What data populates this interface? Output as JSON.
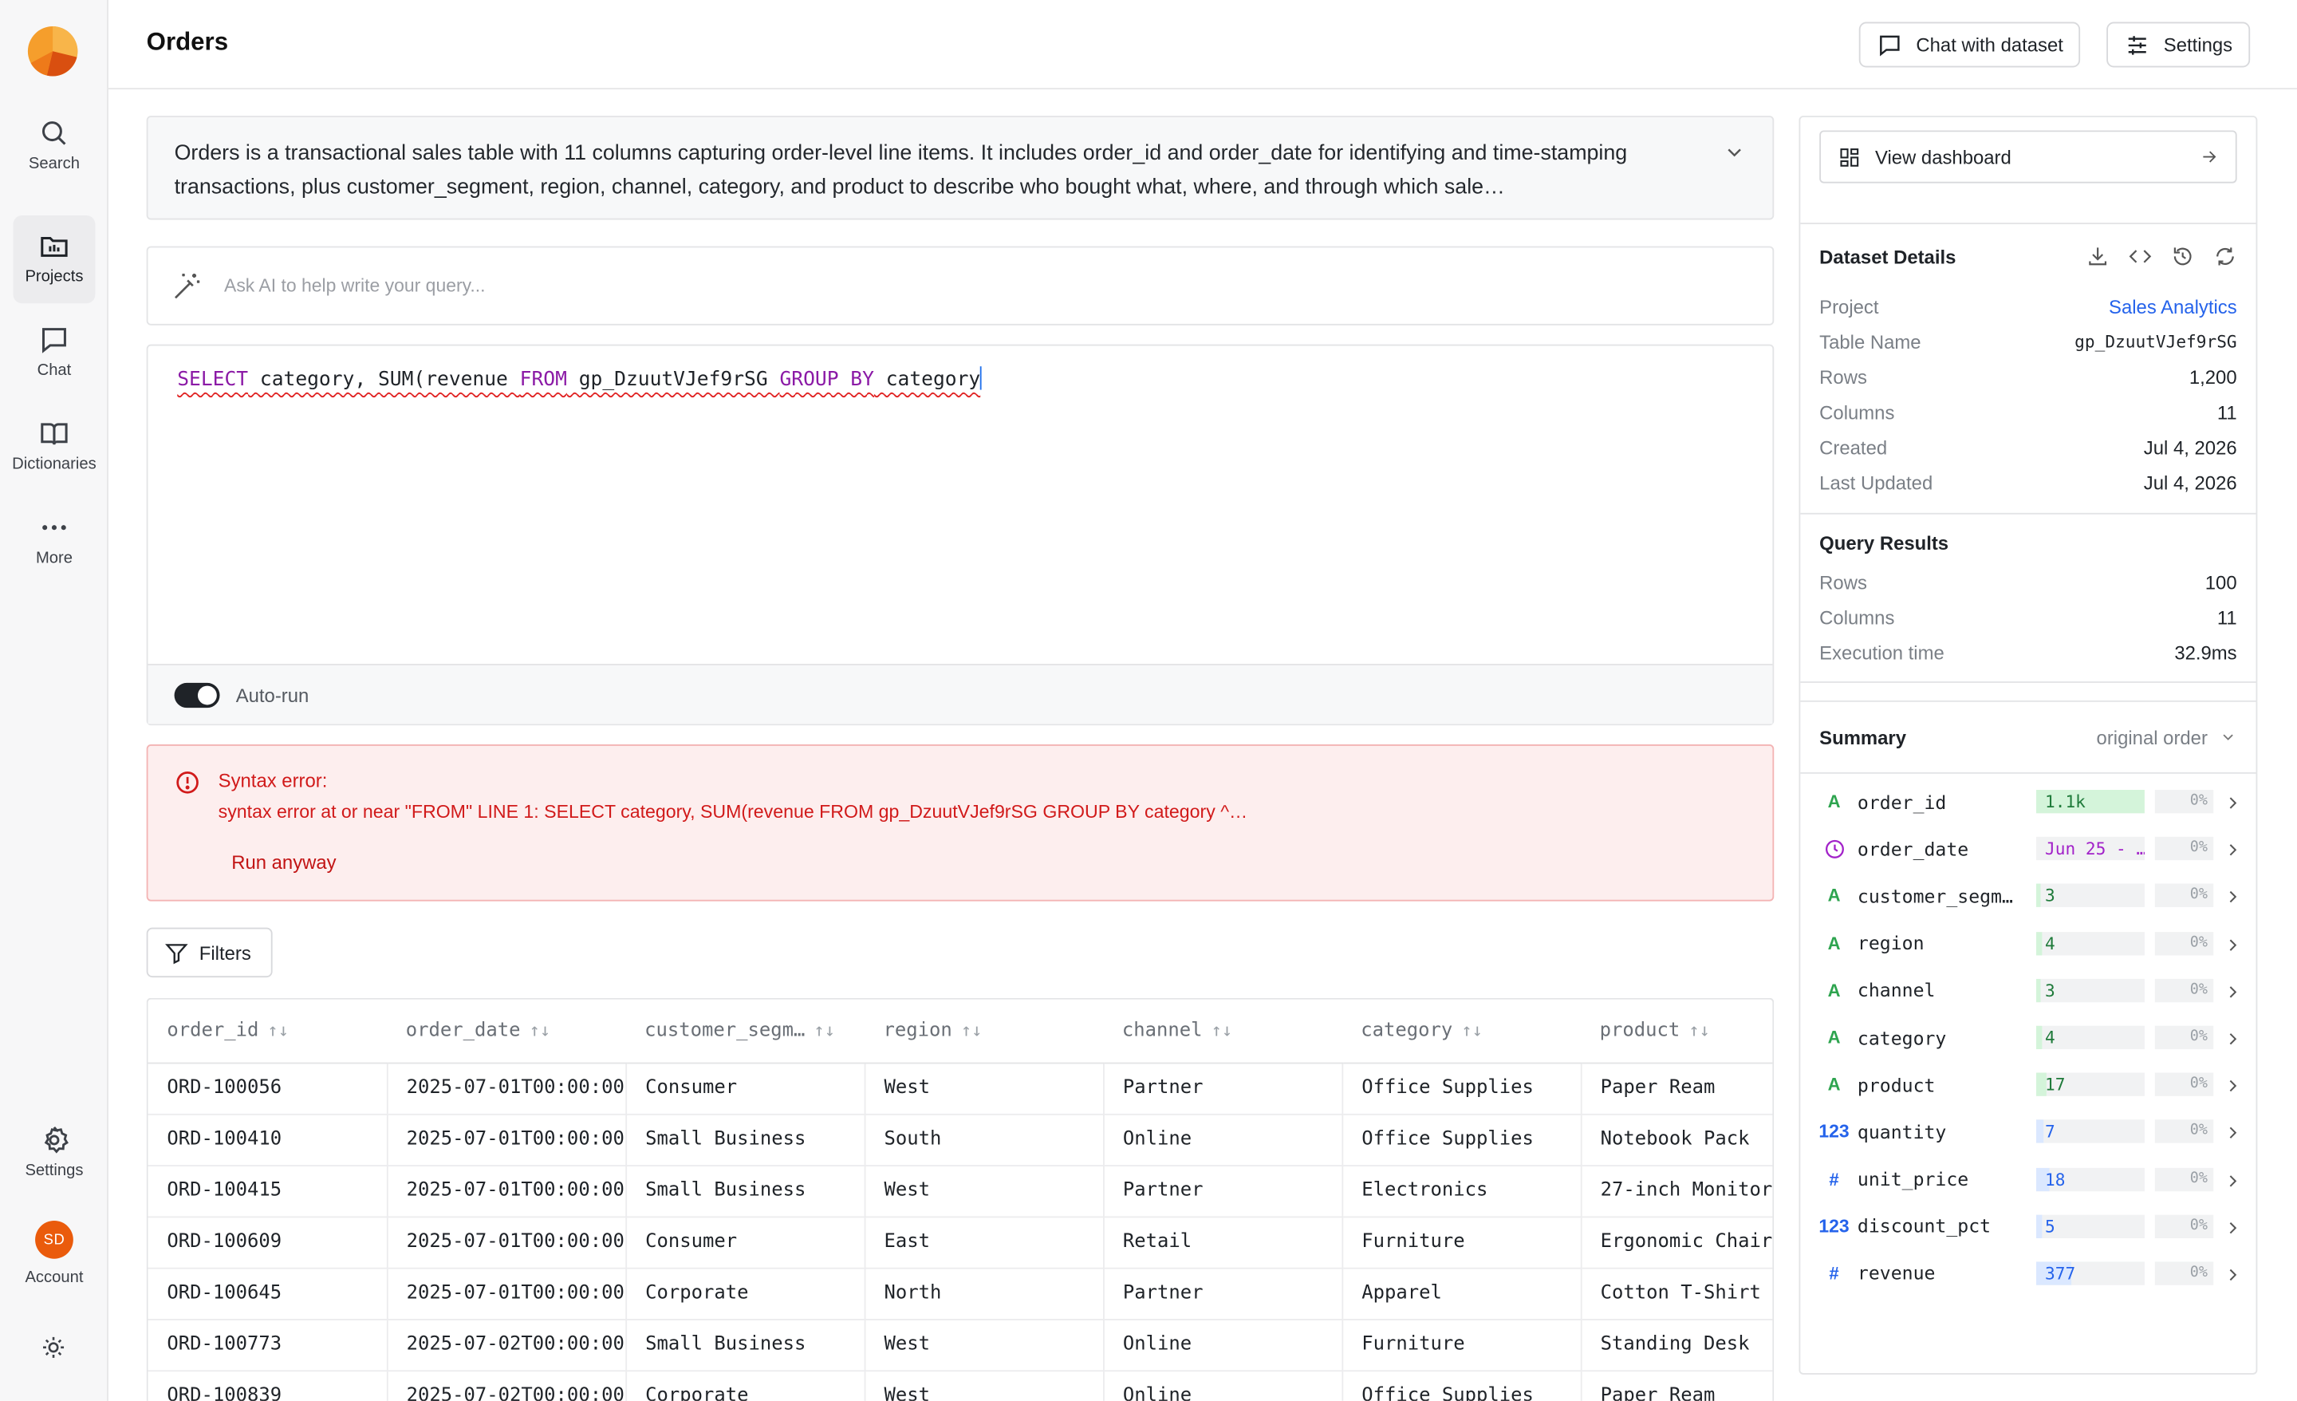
{
  "app": {
    "page_title": "Orders",
    "buttons": {
      "chat": "Chat with dataset",
      "settings": "Settings"
    }
  },
  "rail": {
    "items": [
      {
        "label": "Search",
        "icon": "search-icon"
      },
      {
        "label": "Projects",
        "icon": "folder-icon",
        "active": true
      },
      {
        "label": "Chat",
        "icon": "chat-icon"
      },
      {
        "label": "Dictionaries",
        "icon": "book-icon"
      },
      {
        "label": "More",
        "icon": "more-icon"
      }
    ],
    "bottom": {
      "settings": "Settings",
      "account": "Account",
      "avatar_initials": "SD"
    }
  },
  "description": "Orders is a transactional sales table with 11 columns capturing order-level line items. It includes order_id and order_date for identifying and time-stamping transactions, plus customer_segment, region, channel, category, and product to describe who bought what, where, and through which sale…",
  "ai": {
    "placeholder": "Ask AI to help write your query..."
  },
  "editor": {
    "tokens": [
      {
        "t": "SELECT",
        "kw": true
      },
      {
        "t": " category, SUM(revenue ",
        "kw": false
      },
      {
        "t": "FROM",
        "kw": true
      },
      {
        "t": " gp_DzuutVJef9rSG ",
        "kw": false
      },
      {
        "t": "GROUP BY",
        "kw": true
      },
      {
        "t": " category",
        "kw": false
      }
    ],
    "autorun_label": "Auto-run",
    "autorun_on": true
  },
  "error": {
    "title": "Syntax error:",
    "message": "syntax error at or near \"FROM\" LINE 1: SELECT category, SUM(revenue FROM gp_DzuutVJef9rSG GROUP BY category ^…",
    "run_anyway": "Run anyway"
  },
  "filters_label": "Filters",
  "table": {
    "columns": [
      "order_id",
      "order_date",
      "customer_segm…",
      "region",
      "channel",
      "category",
      "product"
    ],
    "rows": [
      [
        "ORD-100056",
        "2025-07-01T00:00:00",
        "Consumer",
        "West",
        "Partner",
        "Office Supplies",
        "Paper Ream"
      ],
      [
        "ORD-100410",
        "2025-07-01T00:00:00",
        "Small Business",
        "South",
        "Online",
        "Office Supplies",
        "Notebook Pack"
      ],
      [
        "ORD-100415",
        "2025-07-01T00:00:00",
        "Small Business",
        "West",
        "Partner",
        "Electronics",
        "27-inch Monitor"
      ],
      [
        "ORD-100609",
        "2025-07-01T00:00:00",
        "Consumer",
        "East",
        "Retail",
        "Furniture",
        "Ergonomic Chair"
      ],
      [
        "ORD-100645",
        "2025-07-01T00:00:00",
        "Corporate",
        "North",
        "Partner",
        "Apparel",
        "Cotton T-Shirt"
      ],
      [
        "ORD-100773",
        "2025-07-02T00:00:00",
        "Small Business",
        "West",
        "Online",
        "Furniture",
        "Standing Desk"
      ],
      [
        "ORD-100839",
        "2025-07-02T00:00:00",
        "Corporate",
        "West",
        "Online",
        "Office Supplies",
        "Paper Ream"
      ]
    ]
  },
  "panel": {
    "dashboard_label": "View dashboard",
    "details": {
      "title": "Dataset Details",
      "items": [
        {
          "k": "Project",
          "v": "Sales Analytics",
          "kind": "link"
        },
        {
          "k": "Table Name",
          "v": "gp_DzuutVJef9rSG",
          "kind": "mono"
        },
        {
          "k": "Rows",
          "v": "1,200"
        },
        {
          "k": "Columns",
          "v": "11"
        },
        {
          "k": "Created",
          "v": "Jul 4, 2026"
        },
        {
          "k": "Last Updated",
          "v": "Jul 4, 2026"
        }
      ]
    },
    "results": {
      "title": "Query Results",
      "items": [
        {
          "k": "Rows",
          "v": "100"
        },
        {
          "k": "Columns",
          "v": "11"
        },
        {
          "k": "Execution time",
          "v": "32.9ms"
        }
      ]
    },
    "summary": {
      "title": "Summary",
      "order": "original order",
      "columns": [
        {
          "type": "A",
          "kind": "text",
          "name": "order_id",
          "unique": "1.1k",
          "fill": 1.0,
          "fill_color": "#d4f4da",
          "txt_color": "#1f7a3a",
          "nulls": "0%"
        },
        {
          "type": "clock",
          "kind": "date",
          "name": "order_date",
          "unique": "Jun 25 - …",
          "fill": 0.0,
          "fill_color": "#f1f2f3",
          "txt_color": "#a222c9",
          "nulls": "0%"
        },
        {
          "type": "A",
          "kind": "text",
          "name": "customer_segm…",
          "unique": "3",
          "fill": 0.04,
          "fill_color": "#d4f4da",
          "txt_color": "#1f7a3a",
          "nulls": "0%"
        },
        {
          "type": "A",
          "kind": "text",
          "name": "region",
          "unique": "4",
          "fill": 0.05,
          "fill_color": "#d4f4da",
          "txt_color": "#1f7a3a",
          "nulls": "0%"
        },
        {
          "type": "A",
          "kind": "text",
          "name": "channel",
          "unique": "3",
          "fill": 0.04,
          "fill_color": "#d4f4da",
          "txt_color": "#1f7a3a",
          "nulls": "0%"
        },
        {
          "type": "A",
          "kind": "text",
          "name": "category",
          "unique": "4",
          "fill": 0.05,
          "fill_color": "#d4f4da",
          "txt_color": "#1f7a3a",
          "nulls": "0%"
        },
        {
          "type": "A",
          "kind": "text",
          "name": "product",
          "unique": "17",
          "fill": 0.1,
          "fill_color": "#d4f4da",
          "txt_color": "#1f7a3a",
          "nulls": "0%"
        },
        {
          "type": "123",
          "kind": "num",
          "name": "quantity",
          "unique": "7",
          "fill": 0.07,
          "fill_color": "#dbe8ff",
          "txt_color": "#2563eb",
          "nulls": "0%"
        },
        {
          "type": "#",
          "kind": "hash",
          "name": "unit_price",
          "unique": "18",
          "fill": 0.12,
          "fill_color": "#dbe8ff",
          "txt_color": "#2563eb",
          "nulls": "0%"
        },
        {
          "type": "123",
          "kind": "num",
          "name": "discount_pct",
          "unique": "5",
          "fill": 0.06,
          "fill_color": "#dbe8ff",
          "txt_color": "#2563eb",
          "nulls": "0%"
        },
        {
          "type": "#",
          "kind": "hash",
          "name": "revenue",
          "unique": "377",
          "fill": 0.33,
          "fill_color": "#dbe8ff",
          "txt_color": "#2563eb",
          "nulls": "0%"
        }
      ]
    }
  }
}
